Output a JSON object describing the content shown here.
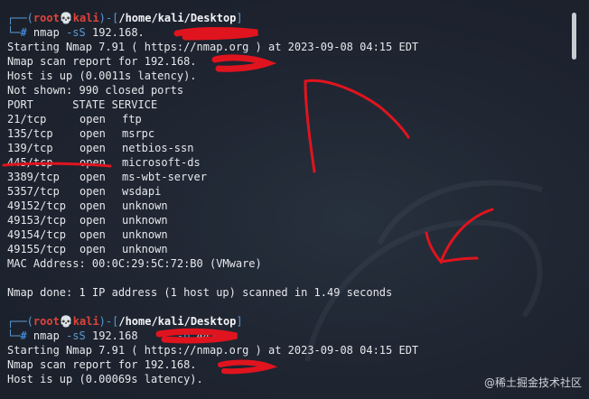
{
  "prompt1": {
    "user": "root",
    "skull": "💀",
    "host": "kali",
    "path": "/home/kali/Desktop",
    "command": "nmap",
    "flag": "-sS",
    "target": "192.168."
  },
  "output1": {
    "starting": "Starting Nmap 7.91 ( https://nmap.org ) at 2023-09-08 04:15 EDT",
    "report": "Nmap scan report for 192.168.",
    "hostup": "Host is up (0.0011s latency).",
    "notshown": "Not shown: 990 closed ports",
    "header": "PORT      STATE SERVICE",
    "ports": [
      {
        "port": "21/tcp",
        "state": "open",
        "service": "ftp"
      },
      {
        "port": "135/tcp",
        "state": "open",
        "service": "msrpc"
      },
      {
        "port": "139/tcp",
        "state": "open",
        "service": "netbios-ssn"
      },
      {
        "port": "445/tcp",
        "state": "open",
        "service": "microsoft-ds"
      },
      {
        "port": "3389/tcp",
        "state": "open",
        "service": "ms-wbt-server"
      },
      {
        "port": "5357/tcp",
        "state": "open",
        "service": "wsdapi"
      },
      {
        "port": "49152/tcp",
        "state": "open",
        "service": "unknown"
      },
      {
        "port": "49153/tcp",
        "state": "open",
        "service": "unknown"
      },
      {
        "port": "49154/tcp",
        "state": "open",
        "service": "unknown"
      },
      {
        "port": "49155/tcp",
        "state": "open",
        "service": "unknown"
      }
    ],
    "mac": "MAC Address: 00:0C:29:5C:72:B0 (VMware)",
    "done": "Nmap done: 1 IP address (1 host up) scanned in 1.49 seconds"
  },
  "prompt2": {
    "user": "root",
    "skull": "💀",
    "host": "kali",
    "path": "/home/kali/Desktop",
    "command": "nmap",
    "flag": "-sS",
    "target": "192.168",
    "flag2": "-p",
    "port": "445"
  },
  "output2": {
    "starting": "Starting Nmap 7.91 ( https://nmap.org ) at 2023-09-08 04:15 EDT",
    "report": "Nmap scan report for 192.168.",
    "hostup": "Host is up (0.00069s latency)."
  },
  "watermark": "@稀土掘金技术社区",
  "colors": {
    "background": "#1e2430",
    "prompt_frame": "#5b9bd5",
    "user_host": "#e0433a",
    "annotation": "#e0141e"
  }
}
